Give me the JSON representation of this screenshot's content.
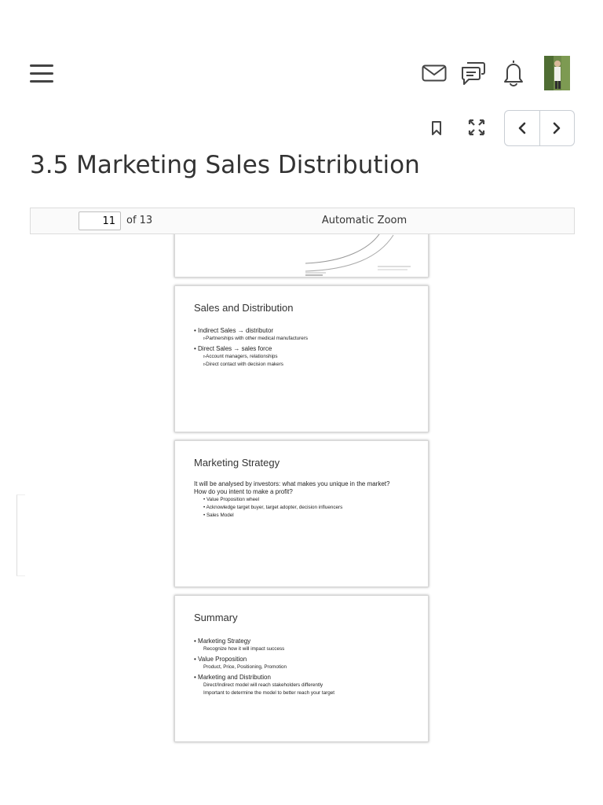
{
  "header": {
    "icons": [
      "menu-icon",
      "mail-icon",
      "chat-icon",
      "bell-icon"
    ]
  },
  "toolbar": {
    "icons": [
      "bookmark-icon",
      "fullscreen-icon",
      "chevron-left-icon",
      "chevron-right-icon"
    ]
  },
  "page_title": "3.5 Marketing Sales Distribution",
  "viewer": {
    "current_page": "11",
    "of_label": "of 13",
    "zoom_label": "Automatic Zoom"
  },
  "slides": [
    {
      "title": "Sales and Distribution",
      "items": [
        {
          "text": "• Indirect Sales → distributor",
          "sub": [
            "▹Partnerships with other medical manufacturers"
          ]
        },
        {
          "text": "• Direct Sales → sales force",
          "sub": [
            "▹Account managers, relationships",
            "▹Direct contact with decision makers"
          ]
        }
      ]
    },
    {
      "title": "Marketing Strategy",
      "intro": [
        "It will be analysed by investors: what makes you unique in the market?",
        "How do you intent to make a profit?"
      ],
      "bullets": [
        "• Value Proposition wheel",
        "• Acknowledge target buyer, target adopter, decision influencers",
        "• Sales Model"
      ]
    },
    {
      "title": "Summary",
      "items": [
        {
          "text": "• Marketing Strategy",
          "sub": [
            "Recognize how it will impact success"
          ]
        },
        {
          "text": "• Value Proposition",
          "sub": [
            "Product, Price, Positioning, Promotion"
          ]
        },
        {
          "text": "• Marketing and Distribution",
          "sub": [
            "Direct/Indirect model will reach stakeholders differently",
            "Important to determine the model to better reach your target"
          ]
        }
      ]
    }
  ]
}
